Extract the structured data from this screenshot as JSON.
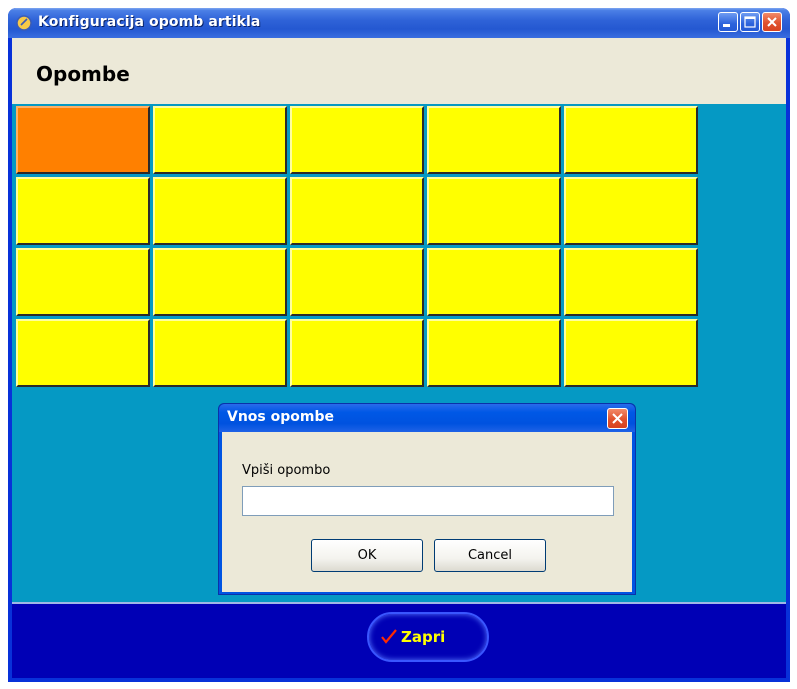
{
  "window": {
    "title": "Konfiguracija opomb artikla"
  },
  "header": {
    "title": "Opombe"
  },
  "grid": {
    "rows": 4,
    "cols": 5,
    "active_cell": 0,
    "colors": {
      "cell": "#ffff00",
      "active": "#ff8000",
      "background": "#0599c4"
    }
  },
  "dialog": {
    "title": "Vnos opombe",
    "label": "Vpiši opombo",
    "input_value": "",
    "ok_label": "OK",
    "cancel_label": "Cancel"
  },
  "footer": {
    "close_label": "Zapri",
    "close_icon": "check-icon"
  }
}
